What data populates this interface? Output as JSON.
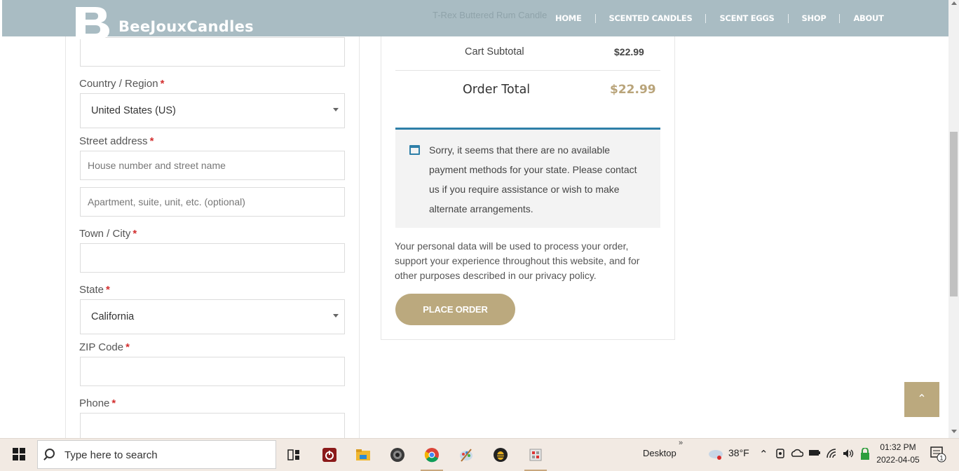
{
  "header": {
    "brand_initial": "B",
    "brand_name": "BeeJouxCandles",
    "ghost_product": "T-Rex Buttered Rum Candle",
    "nav": [
      "HOME",
      "SCENTED CANDLES",
      "SCENT EGGS",
      "SHOP",
      "ABOUT"
    ]
  },
  "form": {
    "country_label": "Country / Region",
    "country_value": "United States (US)",
    "street_label": "Street address",
    "street_placeholder": "House number and street name",
    "apt_placeholder": "Apartment, suite, unit, etc. (optional)",
    "city_label": "Town / City",
    "state_label": "State",
    "state_value": "California",
    "zip_label": "ZIP Code",
    "phone_label": "Phone",
    "required_mark": "*"
  },
  "order": {
    "subtotal_label": "Cart Subtotal",
    "subtotal_value": "$22.99",
    "total_label": "Order Total",
    "total_value": "$22.99",
    "notice": "Sorry, it seems that there are no available payment methods for your state. Please contact us if you require assistance or wish to make alternate arrangements.",
    "privacy": "Your personal data will be used to process your order, support your experience throughout this website, and for other purposes described in our privacy policy.",
    "place_order": "PLACE ORDER"
  },
  "back_to_top_icon": "double-chevron-up-icon",
  "taskbar": {
    "search_placeholder": "Type here to search",
    "desktop_label": "Desktop",
    "overflow_chevron": "»",
    "temperature": "38°F",
    "time": "01:32 PM",
    "date": "2022-04-05",
    "notification_count": "1",
    "apps": [
      "task-view-icon",
      "power-app-icon",
      "file-explorer-icon",
      "speaker-app-icon",
      "chrome-icon",
      "paint-app-icon",
      "bee-app-icon",
      "store-app-icon"
    ]
  },
  "colors": {
    "header_bg": "#a9bcc3",
    "accent_gold": "#bba97e",
    "notice_border": "#2e7fa8",
    "required_red": "#d32f2f"
  }
}
